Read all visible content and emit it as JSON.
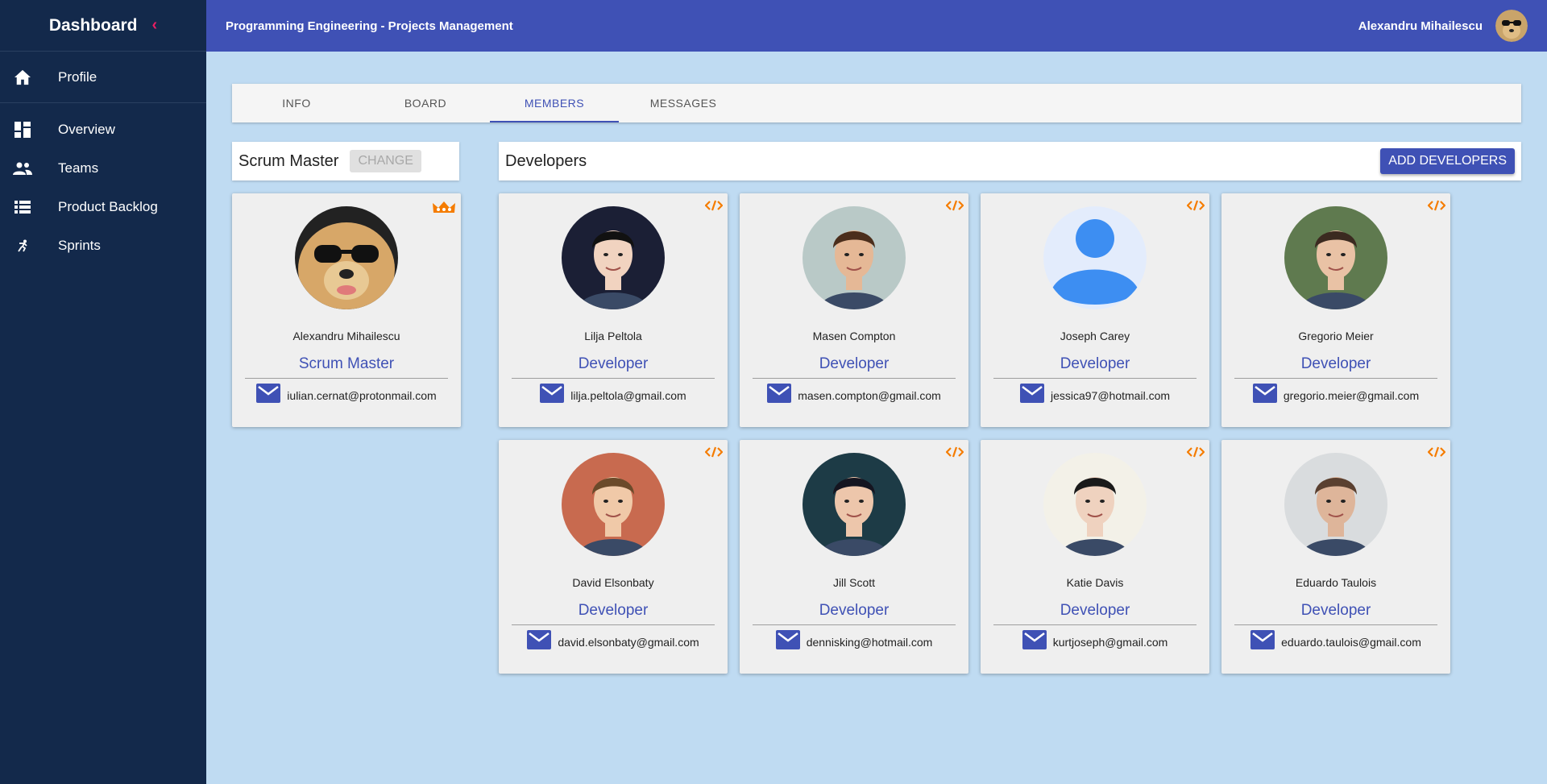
{
  "sidebar": {
    "title": "Dashboard",
    "profile_label": "Profile",
    "items": [
      {
        "label": "Overview"
      },
      {
        "label": "Teams"
      },
      {
        "label": "Product Backlog"
      },
      {
        "label": "Sprints"
      }
    ]
  },
  "header": {
    "title": "Programming Engineering - Projects Management",
    "user_name": "Alexandru Mihailescu"
  },
  "tabs": [
    {
      "label": "INFO"
    },
    {
      "label": "BOARD"
    },
    {
      "label": "MEMBERS"
    },
    {
      "label": "MESSAGES"
    }
  ],
  "scrum_section": {
    "title": "Scrum Master",
    "change_label": "CHANGE"
  },
  "dev_section": {
    "title": "Developers",
    "add_label": "ADD DEVELOPERS"
  },
  "scrum_master": {
    "name": "Alexandru Mihailescu",
    "role": "Scrum Master",
    "email": "iulian.cernat@protonmail.com"
  },
  "developers": [
    {
      "name": "Lilja Peltola",
      "role": "Developer",
      "email": "lilja.peltola@gmail.com"
    },
    {
      "name": "Masen Compton",
      "role": "Developer",
      "email": "masen.compton@gmail.com"
    },
    {
      "name": "Joseph Carey",
      "role": "Developer",
      "email": "jessica97@hotmail.com"
    },
    {
      "name": "Gregorio Meier",
      "role": "Developer",
      "email": "gregorio.meier@gmail.com"
    },
    {
      "name": "David Elsonbaty",
      "role": "Developer",
      "email": "david.elsonbaty@gmail.com"
    },
    {
      "name": "Jill Scott",
      "role": "Developer",
      "email": "dennisking@hotmail.com"
    },
    {
      "name": "Katie Davis",
      "role": "Developer",
      "email": "kurtjoseph@gmail.com"
    },
    {
      "name": "Eduardo Taulois",
      "role": "Developer",
      "email": "eduardo.taulois@gmail.com"
    }
  ],
  "colors": {
    "sidebar_bg": "#13294b",
    "primary": "#3f51b5",
    "accent_collapse": "#e91e63",
    "badge_orange": "#f57c00",
    "page_bg": "#bfdbf2"
  }
}
